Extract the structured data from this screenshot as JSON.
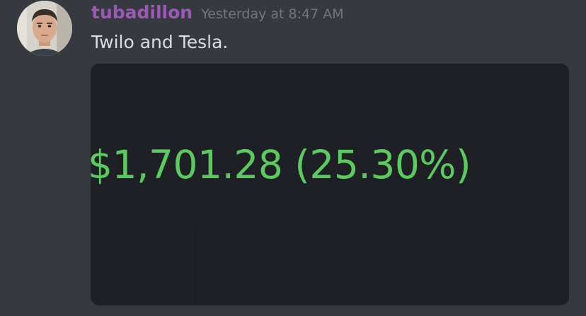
{
  "message": {
    "username": "tubadillon",
    "timestamp": "Yesterday at 8:47 AM",
    "text": "Twilo and Tesla.",
    "attachment": {
      "gain_text": "$1,701.28 (25.30%)"
    }
  },
  "colors": {
    "background": "#36393f",
    "username": "#9b59b6",
    "gain": "#5bcb5f",
    "attachment_bg": "#1e2025"
  }
}
